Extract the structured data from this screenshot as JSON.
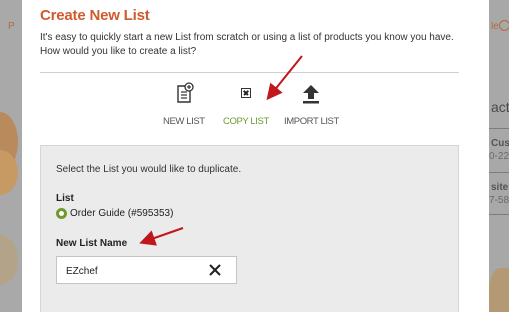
{
  "background_page": {
    "left_fragment": "P",
    "right_orange_fragment": "le",
    "right_heading_fragment": "act",
    "right_line_1": "Cus",
    "right_line_2": "0-22",
    "right_line_3": "site",
    "right_line_4": "7-58"
  },
  "modal": {
    "title": "Create New List",
    "intro": "It's easy to quickly start a new List from scratch or using a list of products you know you have. How would you like to create a list?",
    "options": [
      {
        "label": "NEW LIST",
        "icon": "new-list-icon",
        "active": false
      },
      {
        "label": "COPY LIST",
        "icon": "broken-image-icon",
        "active": true
      },
      {
        "label": "IMPORT LIST",
        "icon": "upload-icon",
        "active": false
      }
    ],
    "panel": {
      "prompt": "Select the List you would like to duplicate.",
      "list_label": "List",
      "selected_list": "Order Guide (#595353)",
      "new_name_label": "New List Name",
      "new_name_value": "EZchef",
      "clear_icon": "close-icon"
    }
  },
  "colors": {
    "title_orange": "#cf5b2e",
    "active_green": "#6e9a2e",
    "arrow_red": "#c0161c",
    "panel_gray": "#ebebeb"
  }
}
